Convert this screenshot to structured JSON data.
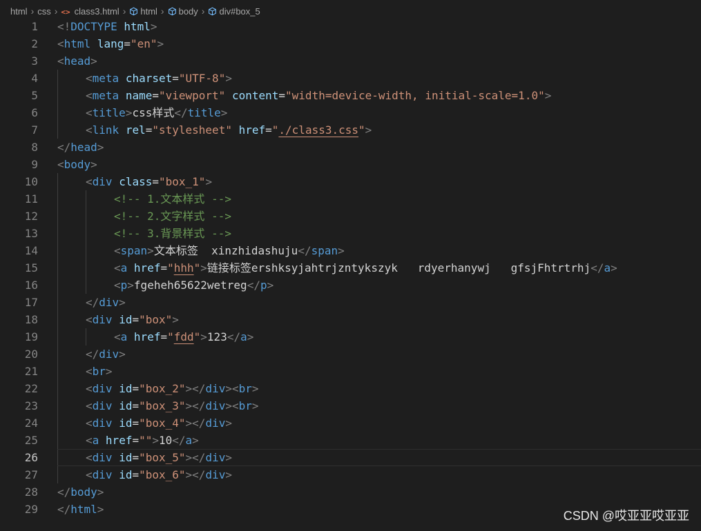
{
  "breadcrumb": [
    {
      "label": "html",
      "icon": null
    },
    {
      "label": "css",
      "icon": null
    },
    {
      "label": "class3.html",
      "icon": "html-file-icon"
    },
    {
      "label": "html",
      "icon": "cube-icon"
    },
    {
      "label": "body",
      "icon": "cube-icon"
    },
    {
      "label": "div#box_5",
      "icon": "cube-icon"
    }
  ],
  "current_line": 26,
  "lines": [
    {
      "n": "1",
      "indent": 0,
      "tokens": [
        [
          "bracket",
          "<!"
        ],
        [
          "tag",
          "DOCTYPE"
        ],
        [
          "text",
          " "
        ],
        [
          "attr",
          "html"
        ],
        [
          "bracket",
          ">"
        ]
      ]
    },
    {
      "n": "2",
      "indent": 0,
      "tokens": [
        [
          "bracket",
          "<"
        ],
        [
          "tag",
          "html"
        ],
        [
          "text",
          " "
        ],
        [
          "attr",
          "lang"
        ],
        [
          "eq",
          "="
        ],
        [
          "str",
          "\"en\""
        ],
        [
          "bracket",
          ">"
        ]
      ]
    },
    {
      "n": "3",
      "indent": 0,
      "tokens": [
        [
          "bracket",
          "<"
        ],
        [
          "tag",
          "head"
        ],
        [
          "bracket",
          ">"
        ]
      ]
    },
    {
      "n": "4",
      "indent": 1,
      "tokens": [
        [
          "bracket",
          "<"
        ],
        [
          "tag",
          "meta"
        ],
        [
          "text",
          " "
        ],
        [
          "attr",
          "charset"
        ],
        [
          "eq",
          "="
        ],
        [
          "str",
          "\"UTF-8\""
        ],
        [
          "bracket",
          ">"
        ]
      ]
    },
    {
      "n": "5",
      "indent": 1,
      "tokens": [
        [
          "bracket",
          "<"
        ],
        [
          "tag",
          "meta"
        ],
        [
          "text",
          " "
        ],
        [
          "attr",
          "name"
        ],
        [
          "eq",
          "="
        ],
        [
          "str",
          "\"viewport\""
        ],
        [
          "text",
          " "
        ],
        [
          "attr",
          "content"
        ],
        [
          "eq",
          "="
        ],
        [
          "str",
          "\"width=device-width, initial-scale=1.0\""
        ],
        [
          "bracket",
          ">"
        ]
      ]
    },
    {
      "n": "6",
      "indent": 1,
      "tokens": [
        [
          "bracket",
          "<"
        ],
        [
          "tag",
          "title"
        ],
        [
          "bracket",
          ">"
        ],
        [
          "text",
          "css样式"
        ],
        [
          "bracket",
          "</"
        ],
        [
          "tag",
          "title"
        ],
        [
          "bracket",
          ">"
        ]
      ]
    },
    {
      "n": "7",
      "indent": 1,
      "tokens": [
        [
          "bracket",
          "<"
        ],
        [
          "tag",
          "link"
        ],
        [
          "text",
          " "
        ],
        [
          "attr",
          "rel"
        ],
        [
          "eq",
          "="
        ],
        [
          "str",
          "\"stylesheet\""
        ],
        [
          "text",
          " "
        ],
        [
          "attr",
          "href"
        ],
        [
          "eq",
          "="
        ],
        [
          "str",
          "\""
        ],
        [
          "strlink",
          "./class3.css"
        ],
        [
          "str",
          "\""
        ],
        [
          "bracket",
          ">"
        ]
      ]
    },
    {
      "n": "8",
      "indent": 0,
      "tokens": [
        [
          "bracket",
          "</"
        ],
        [
          "tag",
          "head"
        ],
        [
          "bracket",
          ">"
        ]
      ]
    },
    {
      "n": "9",
      "indent": 0,
      "tokens": [
        [
          "bracket",
          "<"
        ],
        [
          "tag",
          "body"
        ],
        [
          "bracket",
          ">"
        ]
      ]
    },
    {
      "n": "10",
      "indent": 1,
      "tokens": [
        [
          "bracket",
          "<"
        ],
        [
          "tag",
          "div"
        ],
        [
          "text",
          " "
        ],
        [
          "attr",
          "class"
        ],
        [
          "eq",
          "="
        ],
        [
          "str",
          "\"box_1\""
        ],
        [
          "bracket",
          ">"
        ]
      ]
    },
    {
      "n": "11",
      "indent": 2,
      "tokens": [
        [
          "comment",
          "<!-- 1.文本样式 -->"
        ]
      ]
    },
    {
      "n": "12",
      "indent": 2,
      "tokens": [
        [
          "comment",
          "<!-- 2.文字样式 -->"
        ]
      ]
    },
    {
      "n": "13",
      "indent": 2,
      "tokens": [
        [
          "comment",
          "<!-- 3.背景样式 -->"
        ]
      ]
    },
    {
      "n": "14",
      "indent": 2,
      "tokens": [
        [
          "bracket",
          "<"
        ],
        [
          "tag",
          "span"
        ],
        [
          "bracket",
          ">"
        ],
        [
          "text",
          "文本标签  xinzhidashuju"
        ],
        [
          "bracket",
          "</"
        ],
        [
          "tag",
          "span"
        ],
        [
          "bracket",
          ">"
        ]
      ]
    },
    {
      "n": "15",
      "indent": 2,
      "tokens": [
        [
          "bracket",
          "<"
        ],
        [
          "tag",
          "a"
        ],
        [
          "text",
          " "
        ],
        [
          "attr",
          "href"
        ],
        [
          "eq",
          "="
        ],
        [
          "str",
          "\""
        ],
        [
          "strlink",
          "hhh"
        ],
        [
          "str",
          "\""
        ],
        [
          "bracket",
          ">"
        ],
        [
          "text",
          "链接标签ershksyjahtrjzntykszyk   rdyerhanywj   gfsjFhtrtrhj"
        ],
        [
          "bracket",
          "</"
        ],
        [
          "tag",
          "a"
        ],
        [
          "bracket",
          ">"
        ]
      ]
    },
    {
      "n": "16",
      "indent": 2,
      "tokens": [
        [
          "bracket",
          "<"
        ],
        [
          "tag",
          "p"
        ],
        [
          "bracket",
          ">"
        ],
        [
          "text",
          "fgeheh65622wetreg"
        ],
        [
          "bracket",
          "</"
        ],
        [
          "tag",
          "p"
        ],
        [
          "bracket",
          ">"
        ]
      ]
    },
    {
      "n": "17",
      "indent": 1,
      "tokens": [
        [
          "bracket",
          "</"
        ],
        [
          "tag",
          "div"
        ],
        [
          "bracket",
          ">"
        ]
      ]
    },
    {
      "n": "18",
      "indent": 1,
      "tokens": [
        [
          "bracket",
          "<"
        ],
        [
          "tag",
          "div"
        ],
        [
          "text",
          " "
        ],
        [
          "attr",
          "id"
        ],
        [
          "eq",
          "="
        ],
        [
          "str",
          "\"box\""
        ],
        [
          "bracket",
          ">"
        ]
      ]
    },
    {
      "n": "19",
      "indent": 2,
      "tokens": [
        [
          "bracket",
          "<"
        ],
        [
          "tag",
          "a"
        ],
        [
          "text",
          " "
        ],
        [
          "attr",
          "href"
        ],
        [
          "eq",
          "="
        ],
        [
          "str",
          "\""
        ],
        [
          "strlink",
          "fdd"
        ],
        [
          "str",
          "\""
        ],
        [
          "bracket",
          ">"
        ],
        [
          "text",
          "123"
        ],
        [
          "bracket",
          "</"
        ],
        [
          "tag",
          "a"
        ],
        [
          "bracket",
          ">"
        ]
      ]
    },
    {
      "n": "20",
      "indent": 1,
      "tokens": [
        [
          "bracket",
          "</"
        ],
        [
          "tag",
          "div"
        ],
        [
          "bracket",
          ">"
        ]
      ]
    },
    {
      "n": "21",
      "indent": 1,
      "tokens": [
        [
          "bracket",
          "<"
        ],
        [
          "tag",
          "br"
        ],
        [
          "bracket",
          ">"
        ]
      ]
    },
    {
      "n": "22",
      "indent": 1,
      "tokens": [
        [
          "bracket",
          "<"
        ],
        [
          "tag",
          "div"
        ],
        [
          "text",
          " "
        ],
        [
          "attr",
          "id"
        ],
        [
          "eq",
          "="
        ],
        [
          "str",
          "\"box_2\""
        ],
        [
          "bracket",
          "></"
        ],
        [
          "tag",
          "div"
        ],
        [
          "bracket",
          "><"
        ],
        [
          "tag",
          "br"
        ],
        [
          "bracket",
          ">"
        ]
      ]
    },
    {
      "n": "23",
      "indent": 1,
      "tokens": [
        [
          "bracket",
          "<"
        ],
        [
          "tag",
          "div"
        ],
        [
          "text",
          " "
        ],
        [
          "attr",
          "id"
        ],
        [
          "eq",
          "="
        ],
        [
          "str",
          "\"box_3\""
        ],
        [
          "bracket",
          "></"
        ],
        [
          "tag",
          "div"
        ],
        [
          "bracket",
          "><"
        ],
        [
          "tag",
          "br"
        ],
        [
          "bracket",
          ">"
        ]
      ]
    },
    {
      "n": "24",
      "indent": 1,
      "tokens": [
        [
          "bracket",
          "<"
        ],
        [
          "tag",
          "div"
        ],
        [
          "text",
          " "
        ],
        [
          "attr",
          "id"
        ],
        [
          "eq",
          "="
        ],
        [
          "str",
          "\"box_4\""
        ],
        [
          "bracket",
          "></"
        ],
        [
          "tag",
          "div"
        ],
        [
          "bracket",
          ">"
        ]
      ]
    },
    {
      "n": "25",
      "indent": 1,
      "tokens": [
        [
          "bracket",
          "<"
        ],
        [
          "tag",
          "a"
        ],
        [
          "text",
          " "
        ],
        [
          "attr",
          "href"
        ],
        [
          "eq",
          "="
        ],
        [
          "str",
          "\"\""
        ],
        [
          "bracket",
          ">"
        ],
        [
          "text",
          "10"
        ],
        [
          "bracket",
          "</"
        ],
        [
          "tag",
          "a"
        ],
        [
          "bracket",
          ">"
        ]
      ]
    },
    {
      "n": "26",
      "indent": 1,
      "tokens": [
        [
          "bracket",
          "<"
        ],
        [
          "tag",
          "div"
        ],
        [
          "text",
          " "
        ],
        [
          "attr",
          "id"
        ],
        [
          "eq",
          "="
        ],
        [
          "str",
          "\"box_5\""
        ],
        [
          "bracket",
          "></"
        ],
        [
          "tag",
          "div"
        ],
        [
          "bracket",
          ">"
        ]
      ]
    },
    {
      "n": "27",
      "indent": 1,
      "tokens": [
        [
          "bracket",
          "<"
        ],
        [
          "tag",
          "div"
        ],
        [
          "text",
          " "
        ],
        [
          "attr",
          "id"
        ],
        [
          "eq",
          "="
        ],
        [
          "str",
          "\"box_6\""
        ],
        [
          "bracket",
          "></"
        ],
        [
          "tag",
          "div"
        ],
        [
          "bracket",
          ">"
        ]
      ]
    },
    {
      "n": "28",
      "indent": 0,
      "tokens": [
        [
          "bracket",
          "</"
        ],
        [
          "tag",
          "body"
        ],
        [
          "bracket",
          ">"
        ]
      ]
    },
    {
      "n": "29",
      "indent": 0,
      "tokens": [
        [
          "bracket",
          "</"
        ],
        [
          "tag",
          "html"
        ],
        [
          "bracket",
          ">"
        ]
      ]
    }
  ],
  "watermark": "CSDN @哎亚亚哎亚亚",
  "colors": {
    "background": "#1e1e1e",
    "tag": "#569cd6",
    "attr": "#9cdcfe",
    "string": "#ce9178",
    "comment": "#6a9955",
    "bracket": "#808080",
    "text": "#d4d4d4",
    "line_number": "#858585"
  }
}
